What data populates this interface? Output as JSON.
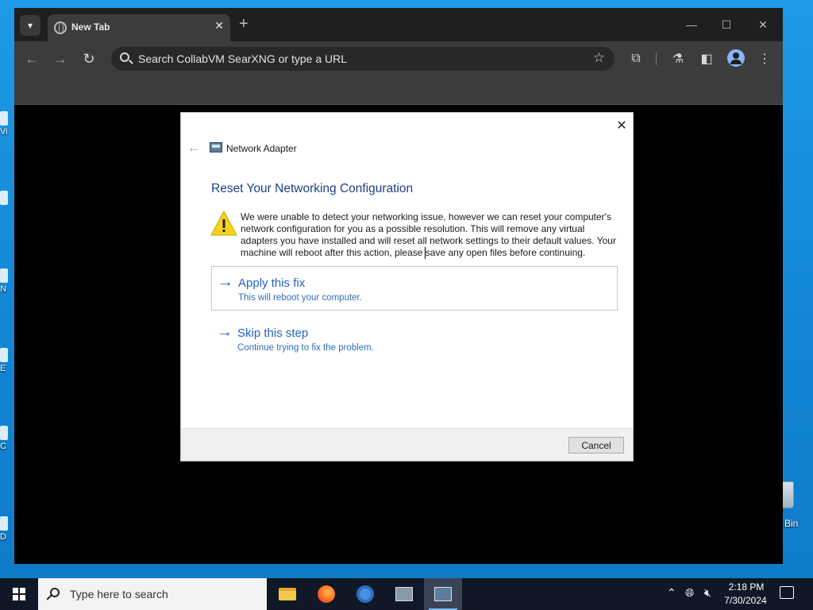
{
  "browser": {
    "tab_title": "New Tab",
    "tab_close": "✕",
    "new_tab": "+",
    "omnibox_placeholder": "Search CollabVM SearXNG or type a URL",
    "window_controls": {
      "minimize": "—",
      "maximize": "☐",
      "close": "✕"
    }
  },
  "dialog": {
    "app_title": "Network Adapter",
    "heading": "Reset Your Networking Configuration",
    "message": "We were unable to detect your networking issue, however we can reset your computer's network configuration for you as a possible resolution. This will remove any virtual adapters you have installed and will reset all network settings to their default values. Your machine will reboot after this action, please save any open files before continuing.",
    "options": [
      {
        "title": "Apply this fix",
        "subtitle": "This will reboot your computer."
      },
      {
        "title": "Skip this step",
        "subtitle": "Continue trying to fix the problem."
      }
    ],
    "cancel_label": "Cancel",
    "close_glyph": "✕"
  },
  "desktop": {
    "recycle_bin_label": "Bin",
    "icon_labels": [
      "Vi",
      "N",
      "E",
      "C",
      "D"
    ]
  },
  "taskbar": {
    "search_placeholder": "Type here to search",
    "time": "2:18 PM",
    "date": "7/30/2024"
  },
  "colors": {
    "accent_link": "#2464b8",
    "heading": "#1f3f87",
    "taskbar": "#101827",
    "browser_chrome": "#3c3c3c"
  }
}
